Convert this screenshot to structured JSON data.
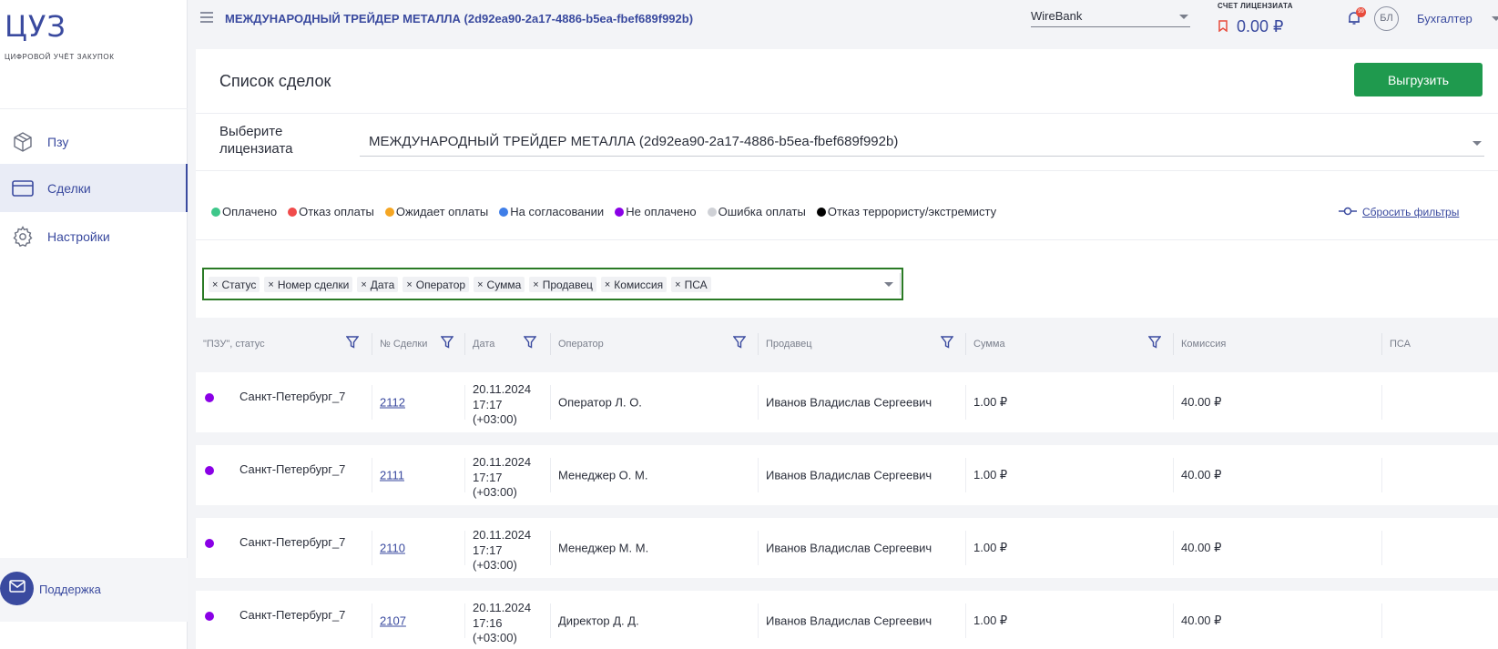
{
  "sidebar": {
    "logo": "ЦУЗ",
    "logo_sub": "ЦИФРОВОЙ УЧЁТ ЗАКУПОК",
    "items": [
      {
        "label": "Пзу"
      },
      {
        "label": "Сделки"
      },
      {
        "label": "Настройки"
      }
    ],
    "support_label": "Поддержка"
  },
  "header": {
    "org_title": "МЕЖДУНАРОДНЫЙ ТРЕЙДЕР МЕТАЛЛА (2d92ea90-2a17-4886-b5ea-fbef689f992b)",
    "bank_value": "WireBank",
    "account_label": "СЧЕТ ЛИЦЕНЗИАТА",
    "account_value": "0.00 ₽",
    "notif_count": "99",
    "avatar_initials": "БЛ",
    "role": "Бухгалтер"
  },
  "page": {
    "title": "Список сделок",
    "export_label": "Выгрузить",
    "licensee_label": "Выберите лицензиата",
    "licensee_value": "МЕЖДУНАРОДНЫЙ ТРЕЙДЕР МЕТАЛЛА (2d92ea90-2a17-4886-b5ea-fbef689f992b)",
    "reset_filters": "Сбросить фильтры"
  },
  "legend": [
    {
      "label": "Оплачено",
      "color": "#3ec78a"
    },
    {
      "label": "Отказ оплаты",
      "color": "#f04b4b"
    },
    {
      "label": "Ожидает оплаты",
      "color": "#f5a623"
    },
    {
      "label": "На согласовании",
      "color": "#3f7ee8"
    },
    {
      "label": "Не оплачено",
      "color": "#8a00e6"
    },
    {
      "label": "Ошибка оплаты",
      "color": "#cfd1d6"
    },
    {
      "label": "Отказ террористу/экстремисту",
      "color": "#000000"
    }
  ],
  "chips": [
    "Статус",
    "Номер сделки",
    "Дата",
    "Оператор",
    "Сумма",
    "Продавец",
    "Комиссия",
    "ПСА"
  ],
  "columns": [
    {
      "label": "\"ПЗУ\", статус"
    },
    {
      "label": "№ Сделки"
    },
    {
      "label": "Дата"
    },
    {
      "label": "Оператор"
    },
    {
      "label": "Продавец"
    },
    {
      "label": "Сумма"
    },
    {
      "label": "Комиссия"
    },
    {
      "label": "ПСА"
    }
  ],
  "rows": [
    {
      "pzu": "Санкт-Петербург_7",
      "deal": "2112",
      "date": "20.11.2024",
      "time": "17:17",
      "tz": "(+03:00)",
      "operator": "Оператор Л. О.",
      "seller": "Иванов Владислав Сергеевич",
      "sum": "1.00 ₽",
      "commission": "40.00 ₽",
      "psa": ""
    },
    {
      "pzu": "Санкт-Петербург_7",
      "deal": "2111",
      "date": "20.11.2024",
      "time": "17:17",
      "tz": "(+03:00)",
      "operator": "Менеджер О. М.",
      "seller": "Иванов Владислав Сергеевич",
      "sum": "1.00 ₽",
      "commission": "40.00 ₽",
      "psa": ""
    },
    {
      "pzu": "Санкт-Петербург_7",
      "deal": "2110",
      "date": "20.11.2024",
      "time": "17:17",
      "tz": "(+03:00)",
      "operator": "Менеджер М. М.",
      "seller": "Иванов Владислав Сергеевич",
      "sum": "1.00 ₽",
      "commission": "40.00 ₽",
      "psa": ""
    },
    {
      "pzu": "Санкт-Петербург_7",
      "deal": "2107",
      "date": "20.11.2024",
      "time": "17:16",
      "tz": "(+03:00)",
      "operator": "Директор Д. Д.",
      "seller": "Иванов Владислав Сергеевич",
      "sum": "1.00 ₽",
      "commission": "40.00 ₽",
      "psa": ""
    }
  ]
}
